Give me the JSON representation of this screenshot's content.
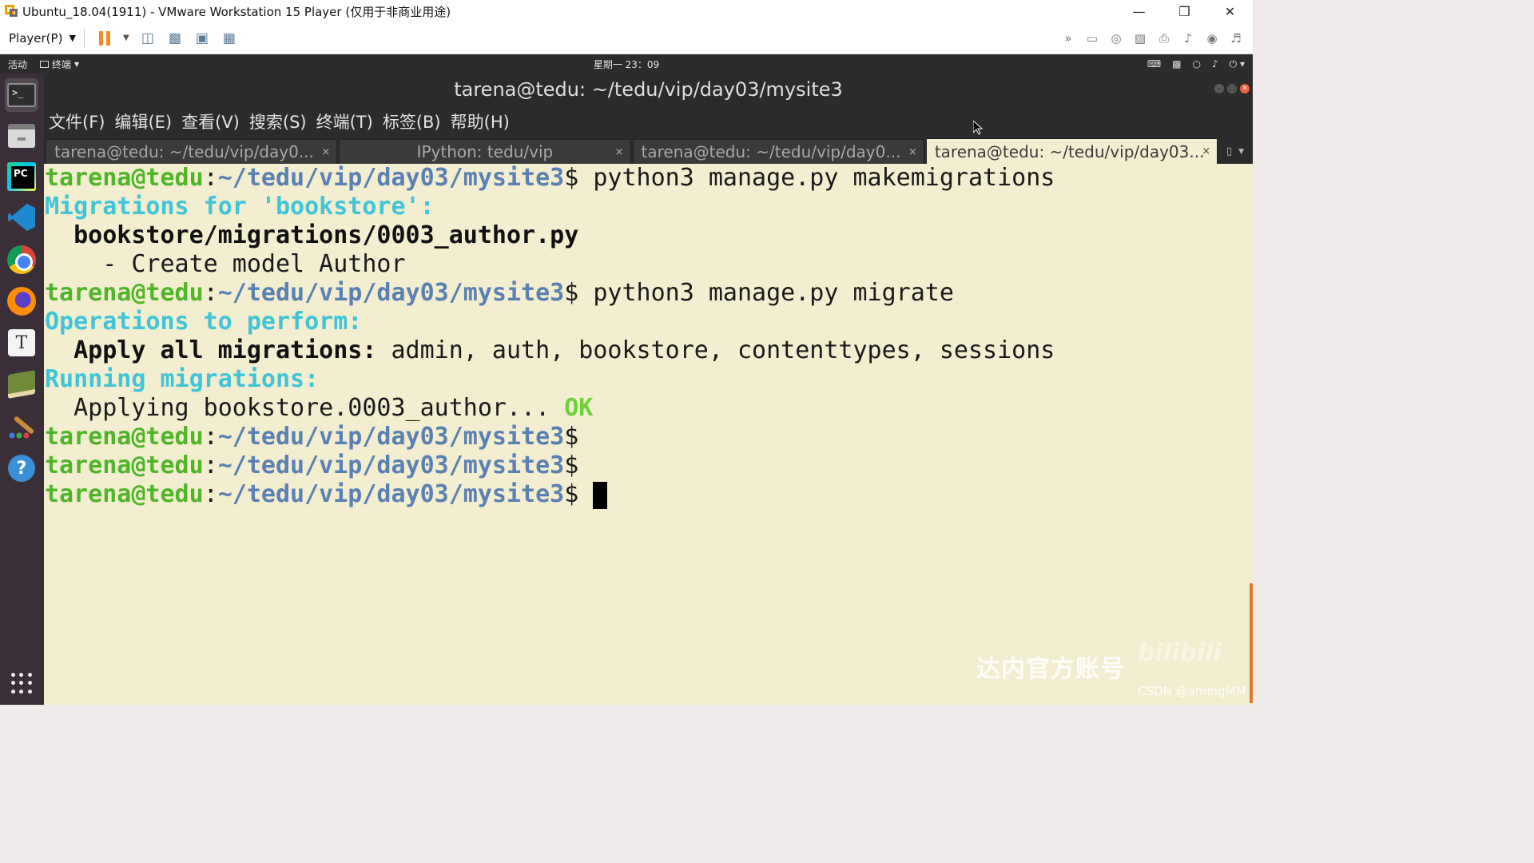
{
  "vmware": {
    "title": "Ubuntu_18.04(1911) - VMware Workstation 15 Player (仅用于非商业用途)",
    "player_menu": "Player(P)"
  },
  "ubuntu_bar": {
    "activities": "活动",
    "app_name": "终端",
    "clock": "星期一 23：09"
  },
  "terminal": {
    "window_title": "tarena@tedu: ~/tedu/vip/day03/mysite3",
    "menu": [
      "文件(F)",
      "编辑(E)",
      "查看(V)",
      "搜索(S)",
      "终端(T)",
      "标签(B)",
      "帮助(H)"
    ],
    "tabs": [
      {
        "label": "tarena@tedu: ~/tedu/vip/day0..."
      },
      {
        "label": "IPython: tedu/vip"
      },
      {
        "label": "tarena@tedu: ~/tedu/vip/day0..."
      },
      {
        "label": "tarena@tedu: ~/tedu/vip/day03..."
      }
    ],
    "prompt_user": "tarena@tedu",
    "prompt_path": "~/tedu/vip/day03/mysite3",
    "prompt_sep": ":",
    "prompt_end": "$",
    "cmd1": " python3 manage.py makemigrations",
    "mig_header": "Migrations for 'bookstore':",
    "mig_file": "  bookstore/migrations/0003_author.py",
    "mig_action": "    - Create model Author",
    "cmd2": " python3 manage.py migrate",
    "ops_header": "Operations to perform:",
    "apply_label": "  Apply all migrations:",
    "apply_value": " admin, auth, bookstore, contenttypes, sessions",
    "running_header": "Running migrations:",
    "applying_text": "  Applying bookstore.0003_author... ",
    "ok_text": "OK"
  },
  "watermark": {
    "text": "达内官方账号",
    "logo": "bilibili",
    "credit": "CSDN @amingMM"
  }
}
